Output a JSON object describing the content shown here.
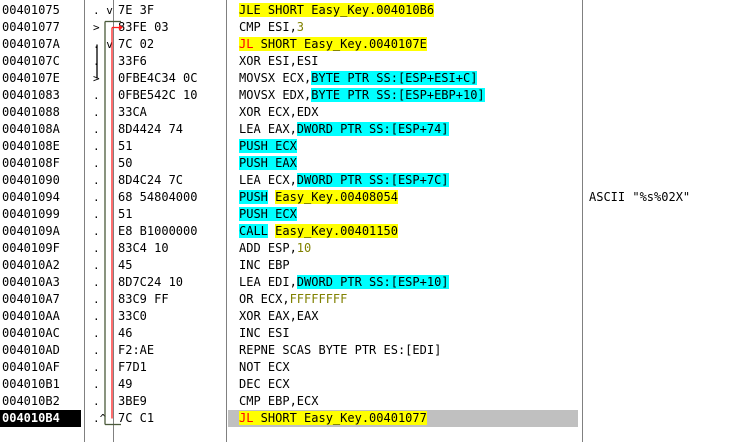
{
  "rows": [
    {
      "addr": "00401075",
      "mark": ". v",
      "hex": "7E 3F",
      "mn": [
        {
          "t": "JLE SHORT Easy_Key.004010B6",
          "c": "hl-jmp"
        }
      ],
      "cmt": ""
    },
    {
      "addr": "00401077",
      "mark": "> ",
      "hex": "83FE 03",
      "mn": [
        {
          "t": "CMP ESI,",
          "c": "hl-plain"
        },
        {
          "t": "3",
          "c": "hl-num"
        }
      ],
      "cmt": ""
    },
    {
      "addr": "0040107A",
      "mark": ". v",
      "hex": "7C 02",
      "mn": [
        {
          "t": "JL",
          "c": "hl-jmp-red"
        },
        {
          "t": " SHORT Easy_Key.0040107E",
          "c": "hl-jmp"
        }
      ],
      "cmt": ""
    },
    {
      "addr": "0040107C",
      "mark": ".",
      "hex": "33F6",
      "mn": [
        {
          "t": "XOR ESI,ESI",
          "c": "hl-plain"
        }
      ],
      "cmt": ""
    },
    {
      "addr": "0040107E",
      "mark": ">",
      "hex": "0FBE4C34 0C",
      "mn": [
        {
          "t": "MOVSX ECX,",
          "c": "hl-plain"
        },
        {
          "t": "BYTE PTR SS:[ESP+ESI+C]",
          "c": "hl-mem"
        }
      ],
      "cmt": ""
    },
    {
      "addr": "00401083",
      "mark": ".",
      "hex": "0FBE542C 10",
      "mn": [
        {
          "t": "MOVSX EDX,",
          "c": "hl-plain"
        },
        {
          "t": "BYTE PTR SS:[ESP+EBP+10]",
          "c": "hl-mem"
        }
      ],
      "cmt": ""
    },
    {
      "addr": "00401088",
      "mark": ".",
      "hex": "33CA",
      "mn": [
        {
          "t": "XOR ECX,EDX",
          "c": "hl-plain"
        }
      ],
      "cmt": ""
    },
    {
      "addr": "0040108A",
      "mark": ".",
      "hex": "8D4424 74",
      "mn": [
        {
          "t": "LEA EAX,",
          "c": "hl-plain"
        },
        {
          "t": "DWORD PTR SS:[ESP+74]",
          "c": "hl-mem"
        }
      ],
      "cmt": ""
    },
    {
      "addr": "0040108E",
      "mark": ".",
      "hex": "51",
      "mn": [
        {
          "t": "PUSH ECX",
          "c": "hl-call"
        }
      ],
      "cmt": ""
    },
    {
      "addr": "0040108F",
      "mark": ".",
      "hex": "50",
      "mn": [
        {
          "t": "PUSH EAX",
          "c": "hl-call"
        }
      ],
      "cmt": ""
    },
    {
      "addr": "00401090",
      "mark": ".",
      "hex": "8D4C24 7C",
      "mn": [
        {
          "t": "LEA ECX,",
          "c": "hl-plain"
        },
        {
          "t": "DWORD PTR SS:[ESP+7C]",
          "c": "hl-mem"
        }
      ],
      "cmt": ""
    },
    {
      "addr": "00401094",
      "mark": ".",
      "hex": "68 54804000",
      "mn": [
        {
          "t": "PUSH",
          "c": "hl-call"
        },
        {
          "t": " ",
          "c": "hl-plain"
        },
        {
          "t": "Easy_Key.00408054",
          "c": "hl-name"
        }
      ],
      "cmt": "ASCII \"%s%02X\""
    },
    {
      "addr": "00401099",
      "mark": ".",
      "hex": "51",
      "mn": [
        {
          "t": "PUSH ECX",
          "c": "hl-call"
        }
      ],
      "cmt": ""
    },
    {
      "addr": "0040109A",
      "mark": ".",
      "hex": "E8 B1000000",
      "mn": [
        {
          "t": "CALL",
          "c": "hl-call"
        },
        {
          "t": " ",
          "c": "hl-plain"
        },
        {
          "t": "Easy_Key.00401150",
          "c": "hl-name"
        }
      ],
      "cmt": ""
    },
    {
      "addr": "0040109F",
      "mark": ".",
      "hex": "83C4 10",
      "mn": [
        {
          "t": "ADD ESP,",
          "c": "hl-plain"
        },
        {
          "t": "10",
          "c": "hl-num"
        }
      ],
      "cmt": ""
    },
    {
      "addr": "004010A2",
      "mark": ".",
      "hex": "45",
      "mn": [
        {
          "t": "INC EBP",
          "c": "hl-plain"
        }
      ],
      "cmt": ""
    },
    {
      "addr": "004010A3",
      "mark": ".",
      "hex": "8D7C24 10",
      "mn": [
        {
          "t": "LEA EDI,",
          "c": "hl-plain"
        },
        {
          "t": "DWORD PTR SS:[ESP+10]",
          "c": "hl-mem"
        }
      ],
      "cmt": ""
    },
    {
      "addr": "004010A7",
      "mark": ".",
      "hex": "83C9 FF",
      "mn": [
        {
          "t": "OR ECX,",
          "c": "hl-plain"
        },
        {
          "t": "FFFFFFFF",
          "c": "hl-neg"
        }
      ],
      "cmt": ""
    },
    {
      "addr": "004010AA",
      "mark": ".",
      "hex": "33C0",
      "mn": [
        {
          "t": "XOR EAX,EAX",
          "c": "hl-plain"
        }
      ],
      "cmt": ""
    },
    {
      "addr": "004010AC",
      "mark": ".",
      "hex": "46",
      "mn": [
        {
          "t": "INC ESI",
          "c": "hl-plain"
        }
      ],
      "cmt": ""
    },
    {
      "addr": "004010AD",
      "mark": ".",
      "hex": "F2:AE",
      "mn": [
        {
          "t": "REPNE SCAS BYTE PTR ES:[EDI]",
          "c": "hl-plain"
        }
      ],
      "cmt": ""
    },
    {
      "addr": "004010AF",
      "mark": ".",
      "hex": "F7D1",
      "mn": [
        {
          "t": "NOT ECX",
          "c": "hl-plain"
        }
      ],
      "cmt": ""
    },
    {
      "addr": "004010B1",
      "mark": ".",
      "hex": "49",
      "mn": [
        {
          "t": "DEC ECX",
          "c": "hl-plain"
        }
      ],
      "cmt": ""
    },
    {
      "addr": "004010B2",
      "mark": ".",
      "hex": "3BE9",
      "mn": [
        {
          "t": "CMP EBP,ECX",
          "c": "hl-plain"
        }
      ],
      "cmt": ""
    },
    {
      "addr": "004010B4",
      "mark": ".^",
      "hex": "7C C1",
      "mn": [
        {
          "t": "JL",
          "c": "hl-jmp-red"
        },
        {
          "t": " SHORT Easy_Key.00401077",
          "c": "hl-jmp"
        }
      ],
      "cmt": "",
      "selected": true
    }
  ]
}
